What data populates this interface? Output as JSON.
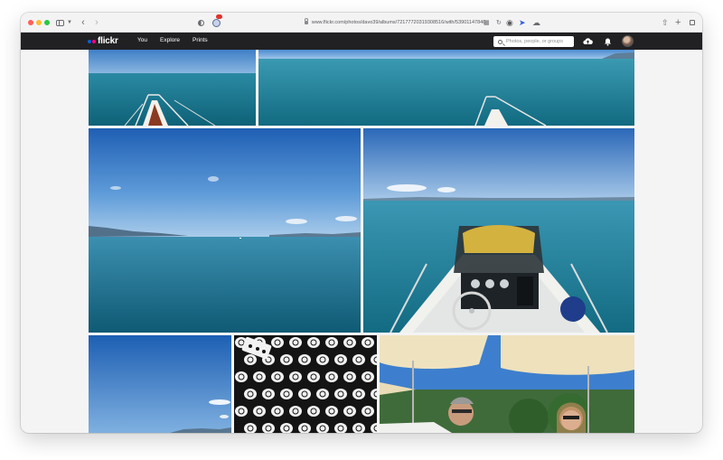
{
  "browser": {
    "url": "www.flickr.com/photos/davo39/albums/72177720319308516/with/53901147840"
  },
  "nav": {
    "logo": "flickr",
    "links": [
      "You",
      "Explore",
      "Prints"
    ],
    "search_placeholder": "Photos, people, or groups"
  },
  "colors": {
    "nav_bg": "#212124",
    "logo_blue": "#0063dc",
    "logo_pink": "#ff0084"
  },
  "gallery": {
    "photos": [
      {
        "name": "photo-lake-bow-left",
        "subject": "boat bow railing on lake"
      },
      {
        "name": "photo-lake-bow-wide",
        "subject": "boat bow railing on lake, wide"
      },
      {
        "name": "photo-lake-horizon",
        "subject": "lake horizon with sky"
      },
      {
        "name": "photo-boat-cockpit",
        "subject": "boat cockpit and steering wheel"
      },
      {
        "name": "photo-sky-mountains",
        "subject": "blue sky over mountains"
      },
      {
        "name": "photo-pattern-fabric",
        "subject": "black fabric with white symbols"
      },
      {
        "name": "photo-people-umbrellas",
        "subject": "two people under parasols"
      }
    ]
  }
}
